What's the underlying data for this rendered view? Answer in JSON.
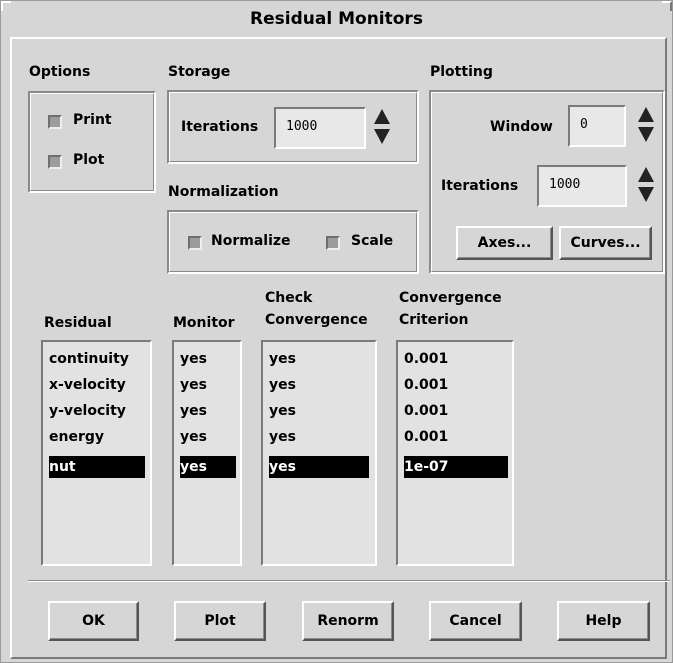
{
  "window": {
    "title": "Residual Monitors"
  },
  "options": {
    "heading": "Options",
    "print_label": "Print",
    "plot_label": "Plot"
  },
  "storage": {
    "heading": "Storage",
    "iterations_label": "Iterations",
    "iterations_value": "1000"
  },
  "normalization": {
    "heading": "Normalization",
    "normalize_label": "Normalize",
    "scale_label": "Scale"
  },
  "plotting": {
    "heading": "Plotting",
    "window_label": "Window",
    "window_value": "0",
    "iterations_label": "Iterations",
    "iterations_value": "1000",
    "axes_button": "Axes...",
    "curves_button": "Curves..."
  },
  "table": {
    "headers": {
      "residual": "Residual",
      "monitor": "Monitor",
      "check_line1": "Check",
      "check_line2": "Convergence",
      "criterion_line1": "Convergence",
      "criterion_line2": "Criterion"
    },
    "residual": [
      "continuity",
      "x-velocity",
      "y-velocity",
      "energy",
      "nut"
    ],
    "monitor": [
      "yes",
      "yes",
      "yes",
      "yes",
      "yes"
    ],
    "check": [
      "yes",
      "yes",
      "yes",
      "yes",
      "yes"
    ],
    "criterion": [
      "0.001",
      "0.001",
      "0.001",
      "0.001",
      "1e-07"
    ],
    "selected_index": 4
  },
  "buttons": {
    "ok": "OK",
    "plot": "Plot",
    "renorm": "Renorm",
    "cancel": "Cancel",
    "help": "Help"
  },
  "colors": {
    "background": "#d6d6d6",
    "field": "#e8e8e8",
    "selection": "#000000"
  }
}
